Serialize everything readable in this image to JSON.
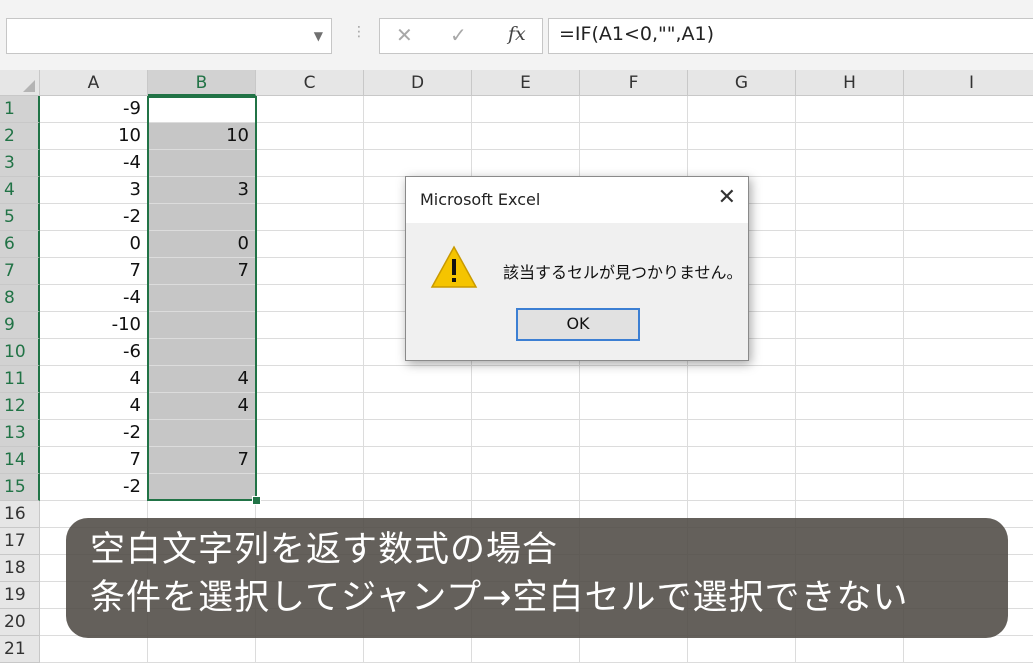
{
  "formula_bar": {
    "name_box_value": "",
    "cancel_glyph": "✕",
    "enter_glyph": "✓",
    "fx_label": "fx",
    "formula": "=IF(A1<0,\"\",A1)"
  },
  "columns": [
    "A",
    "B",
    "C",
    "D",
    "E",
    "F",
    "G",
    "H",
    "I"
  ],
  "rows": [
    "1",
    "2",
    "3",
    "4",
    "5",
    "6",
    "7",
    "8",
    "9",
    "10",
    "11",
    "12",
    "13",
    "14",
    "15",
    "16",
    "17",
    "18",
    "19",
    "20",
    "21"
  ],
  "col_a": [
    "-9",
    "10",
    "-4",
    "3",
    "-2",
    "0",
    "7",
    "-4",
    "-10",
    "-6",
    "4",
    "4",
    "-2",
    "7",
    "-2"
  ],
  "col_b": [
    "",
    "10",
    "",
    "3",
    "",
    "0",
    "7",
    "",
    "",
    "",
    "4",
    "4",
    "",
    "7",
    ""
  ],
  "dialog": {
    "title": "Microsoft Excel",
    "close_glyph": "✕",
    "message": "該当するセルが見つかりません。",
    "ok_label": "OK",
    "icon": "warning-icon",
    "icon_color": "#f5c400"
  },
  "caption": {
    "line1": "空白文字列を返す数式の場合",
    "line2": "条件を選択してジャンプ→空白セルで選択できない"
  },
  "colors": {
    "accent": "#217346",
    "selection_fill": "#c6c6c6",
    "ok_border": "#3c7fd3"
  }
}
